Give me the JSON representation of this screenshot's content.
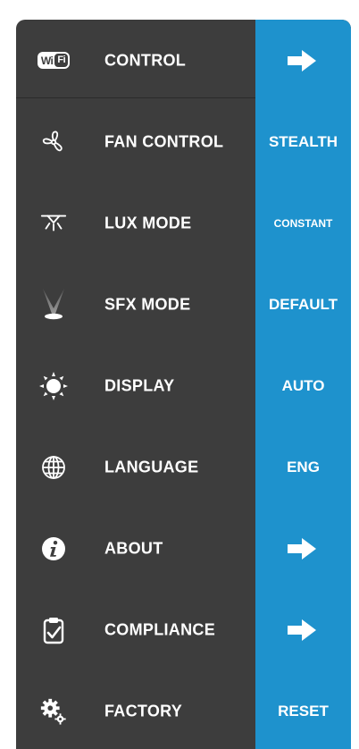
{
  "menu": [
    {
      "label": "CONTROL",
      "icon": "wifi-badge-icon",
      "value": "",
      "action": "arrow"
    },
    {
      "label": "FAN CONTROL",
      "icon": "fan-icon",
      "value": "STEALTH"
    },
    {
      "label": "LUX MODE",
      "icon": "ceiling-lamp-icon",
      "value": "CONSTANT"
    },
    {
      "label": "SFX MODE",
      "icon": "spotlight-icon",
      "value": "DEFAULT"
    },
    {
      "label": "DISPLAY",
      "icon": "sun-icon",
      "value": "AUTO"
    },
    {
      "label": "LANGUAGE",
      "icon": "globe-icon",
      "value": "ENG"
    },
    {
      "label": "ABOUT",
      "icon": "info-icon",
      "value": "",
      "action": "arrow"
    },
    {
      "label": "COMPLIANCE",
      "icon": "clipboard-check-icon",
      "value": "",
      "action": "arrow"
    },
    {
      "label": "FACTORY",
      "icon": "gears-icon",
      "value": "RESET"
    }
  ],
  "badge": {
    "wi": "Wi",
    "fi": "Fi"
  },
  "colors": {
    "panel_background": "#3d3d3d",
    "value_column": "#1e92cd",
    "text": "#ffffff"
  }
}
